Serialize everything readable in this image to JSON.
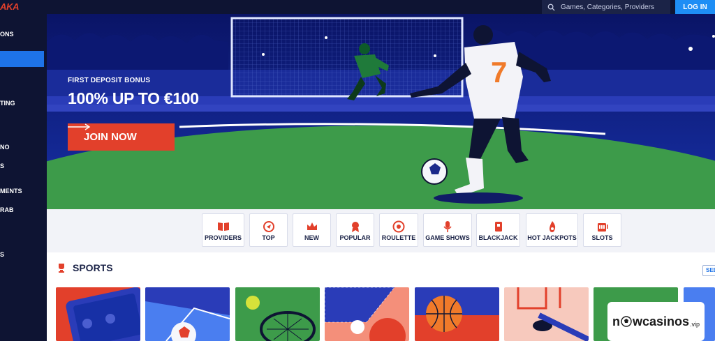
{
  "header": {
    "logo": "AKA",
    "search_placeholder": "Games, Categories, Providers",
    "login_label": "LOG IN"
  },
  "sidebar": {
    "items": [
      {
        "label": "ONS"
      },
      {
        "label": ""
      },
      {
        "label": "TING"
      },
      {
        "label": "NO"
      },
      {
        "label": "S"
      },
      {
        "label": "MENTS"
      },
      {
        "label": "RAB"
      },
      {
        "label": "S"
      }
    ]
  },
  "hero": {
    "subtitle": "FIRST DEPOSIT BONUS",
    "title": "100% UP TO €100",
    "cta": "JOIN NOW"
  },
  "categories": [
    {
      "label": "PROVIDERS",
      "icon": "book-icon"
    },
    {
      "label": "TOP",
      "icon": "top-icon"
    },
    {
      "label": "NEW",
      "icon": "crown-icon"
    },
    {
      "label": "POPULAR",
      "icon": "popular-badge-icon"
    },
    {
      "label": "ROULETTE",
      "icon": "roulette-icon"
    },
    {
      "label": "GAME SHOWS",
      "icon": "microphone-icon"
    },
    {
      "label": "BLACKJACK",
      "icon": "cards-icon"
    },
    {
      "label": "HOT JACKPOTS",
      "icon": "flame-icon"
    },
    {
      "label": "SLOTS",
      "icon": "slot-machine-icon"
    }
  ],
  "sports": {
    "title": "SPORTS",
    "see_all": "SEE",
    "tiles": [
      "tikitaka-app",
      "football",
      "tennis",
      "table-tennis",
      "basketball",
      "ice-hockey",
      "football-field",
      "more"
    ]
  },
  "watermark": {
    "brand_n": "n",
    "brand_rest": "wcasinos",
    "suffix": ".vip"
  },
  "colors": {
    "navy": "#0e1433",
    "accent_blue": "#1e73e8",
    "cta_red": "#e2402b",
    "field_green": "#3d9b4a"
  }
}
